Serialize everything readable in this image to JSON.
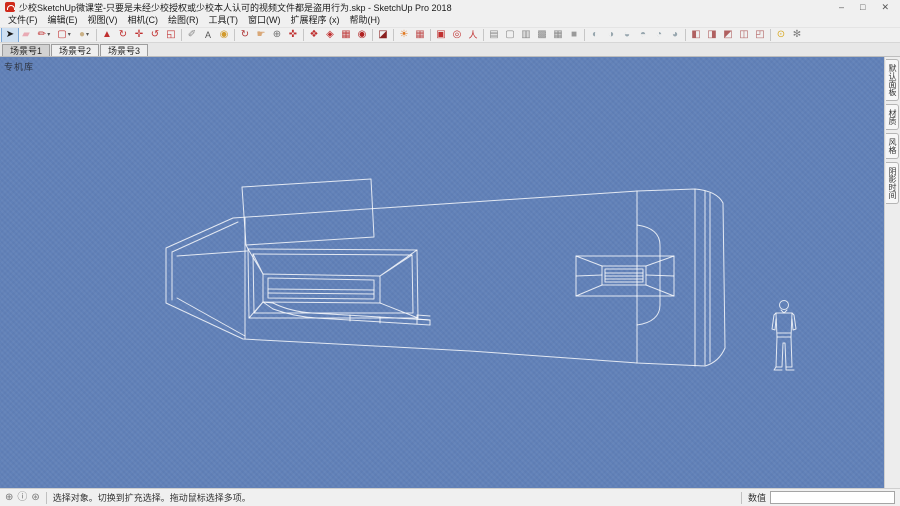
{
  "colors": {
    "viewport_bg": "#6181b8",
    "wireframe": "rgba(255,255,255,0.82)",
    "chrome_bg": "#f0f0f0",
    "logo_red": "#cf2a1b",
    "active_tool_bg": "#cfe0f2"
  },
  "window": {
    "title": "少校SketchUp微课堂-只要是未经少校授权或少校本人认可的视频文件都是盗用行为.skp - SketchUp Pro 2018",
    "controls": {
      "minimize": "–",
      "maximize": "□",
      "close": "✕"
    }
  },
  "menu": {
    "items": [
      {
        "label": "文件(F)"
      },
      {
        "label": "编辑(E)"
      },
      {
        "label": "视图(V)"
      },
      {
        "label": "相机(C)"
      },
      {
        "label": "绘图(R)"
      },
      {
        "label": "工具(T)"
      },
      {
        "label": "窗口(W)"
      },
      {
        "label": "扩展程序 (x)"
      },
      {
        "label": "帮助(H)"
      }
    ]
  },
  "toolbar": {
    "icons": [
      {
        "name": "select-tool-icon",
        "glyph": "➤",
        "style": "color:#1a1a1a",
        "cls": "active",
        "interactable": "true"
      },
      {
        "name": "eraser-tool-icon",
        "glyph": "▰",
        "style": "color:#e9aab4",
        "cls": "",
        "interactable": "true"
      },
      {
        "name": "line-tool-icon",
        "glyph": "✏",
        "style": "color:#c03030",
        "cls": "dd",
        "interactable": "true"
      },
      {
        "name": "shape-tool-icon",
        "glyph": "▢",
        "style": "color:#c03030",
        "cls": "dd",
        "interactable": "true"
      },
      {
        "name": "circle-tool-icon",
        "glyph": "●",
        "style": "color:#c9b086",
        "cls": "dd",
        "interactable": "true"
      },
      {
        "name": "separator",
        "glyph": "",
        "style": "",
        "cls": "tsep",
        "interactable": "false"
      },
      {
        "name": "push-pull-tool-icon",
        "glyph": "▲",
        "style": "color:#c03030",
        "cls": "",
        "interactable": "true"
      },
      {
        "name": "follow-me-tool-icon",
        "glyph": "↻",
        "style": "color:#c03030",
        "cls": "",
        "interactable": "true"
      },
      {
        "name": "move-tool-icon",
        "glyph": "✛",
        "style": "color:#c03030",
        "cls": "",
        "interactable": "true"
      },
      {
        "name": "rotate-tool-icon",
        "glyph": "↺",
        "style": "color:#c03030",
        "cls": "",
        "interactable": "true"
      },
      {
        "name": "scale-tool-icon",
        "glyph": "◱",
        "style": "color:#c03030",
        "cls": "",
        "interactable": "true"
      },
      {
        "name": "separator",
        "glyph": "",
        "style": "",
        "cls": "tsep",
        "interactable": "false"
      },
      {
        "name": "tape-measure-tool-icon",
        "glyph": "✐",
        "style": "color:#8a8a8a",
        "cls": "",
        "interactable": "true"
      },
      {
        "name": "dimension-tool-icon",
        "glyph": "A",
        "style": "color:#555;font-size:9px",
        "cls": "",
        "interactable": "true"
      },
      {
        "name": "paint-bucket-tool-icon",
        "glyph": "◉",
        "style": "color:#d19a2c",
        "cls": "",
        "interactable": "true"
      },
      {
        "name": "separator",
        "glyph": "",
        "style": "",
        "cls": "tsep",
        "interactable": "false"
      },
      {
        "name": "orbit-tool-icon",
        "glyph": "↻",
        "style": "color:#b03838",
        "cls": "",
        "interactable": "true"
      },
      {
        "name": "pan-tool-icon",
        "glyph": "☛",
        "style": "color:#d9a878",
        "cls": "",
        "interactable": "true"
      },
      {
        "name": "zoom-tool-icon",
        "glyph": "⊕",
        "style": "color:#707070",
        "cls": "",
        "interactable": "true"
      },
      {
        "name": "zoom-extents-tool-icon",
        "glyph": "✜",
        "style": "color:#c03030",
        "cls": "",
        "interactable": "true"
      },
      {
        "name": "separator",
        "glyph": "",
        "style": "",
        "cls": "tsep",
        "interactable": "false"
      },
      {
        "name": "make-component-icon",
        "glyph": "❖",
        "style": "color:#c03030",
        "cls": "",
        "interactable": "true"
      },
      {
        "name": "component-options-icon",
        "glyph": "◈",
        "style": "color:#c03030",
        "cls": "",
        "interactable": "true"
      },
      {
        "name": "component-attributes-icon",
        "glyph": "▦",
        "style": "color:#c04040",
        "cls": "",
        "interactable": "true"
      },
      {
        "name": "interact-tool-icon",
        "glyph": "◉",
        "style": "color:#b02020",
        "cls": "",
        "interactable": "true"
      },
      {
        "name": "separator",
        "glyph": "",
        "style": "",
        "cls": "tsep",
        "interactable": "false"
      },
      {
        "name": "section-plane-icon",
        "glyph": "◪",
        "style": "color:#8a2020",
        "cls": "",
        "interactable": "true"
      },
      {
        "name": "separator",
        "glyph": "",
        "style": "",
        "cls": "tsep",
        "interactable": "false"
      },
      {
        "name": "shadows-icon",
        "glyph": "☀",
        "style": "color:#e07820",
        "cls": "",
        "interactable": "true"
      },
      {
        "name": "fog-icon",
        "glyph": "▦",
        "style": "color:#c05050",
        "cls": "",
        "interactable": "true"
      },
      {
        "name": "separator",
        "glyph": "",
        "style": "",
        "cls": "tsep",
        "interactable": "false"
      },
      {
        "name": "position-camera-icon",
        "glyph": "▣",
        "style": "color:#c03030",
        "cls": "",
        "interactable": "true"
      },
      {
        "name": "look-around-icon",
        "glyph": "◎",
        "style": "color:#c03030",
        "cls": "",
        "interactable": "true"
      },
      {
        "name": "walk-tool-icon",
        "glyph": "人",
        "style": "color:#c03030;font-size:9px",
        "cls": "",
        "interactable": "true"
      },
      {
        "name": "separator",
        "glyph": "",
        "style": "",
        "cls": "tsep",
        "interactable": "false"
      },
      {
        "name": "xray-style-icon",
        "glyph": "▤",
        "style": "color:#8a8a8a",
        "cls": "",
        "interactable": "true"
      },
      {
        "name": "wireframe-style-icon",
        "glyph": "▢",
        "style": "color:#8a8a8a",
        "cls": "",
        "interactable": "true"
      },
      {
        "name": "hidden-line-style-icon",
        "glyph": "▥",
        "style": "color:#8a8a8a",
        "cls": "",
        "interactable": "true"
      },
      {
        "name": "shaded-style-icon",
        "glyph": "▩",
        "style": "color:#8a8a8a",
        "cls": "",
        "interactable": "true"
      },
      {
        "name": "textured-style-icon",
        "glyph": "▦",
        "style": "color:#8a8a8a",
        "cls": "",
        "interactable": "true"
      },
      {
        "name": "monochrome-style-icon",
        "glyph": "■",
        "style": "color:#9a9a9a",
        "cls": "",
        "interactable": "true"
      },
      {
        "name": "separator",
        "glyph": "",
        "style": "",
        "cls": "tsep",
        "interactable": "false"
      },
      {
        "name": "add-location-icon",
        "glyph": "◐",
        "style": "color:#97a6ae",
        "cls": "",
        "interactable": "true"
      },
      {
        "name": "toggle-terrain-icon",
        "glyph": "◑",
        "style": "color:#97a6ae",
        "cls": "",
        "interactable": "true"
      },
      {
        "name": "photo-textures-icon",
        "glyph": "◒",
        "style": "color:#97a6ae",
        "cls": "",
        "interactable": "true"
      },
      {
        "name": "globe-icon",
        "glyph": "◓",
        "style": "color:#97a6ae",
        "cls": "",
        "interactable": "true"
      },
      {
        "name": "adv-camera-icon",
        "glyph": "◔",
        "style": "color:#97a6ae",
        "cls": "",
        "interactable": "true"
      },
      {
        "name": "camera-list-icon",
        "glyph": "◕",
        "style": "color:#97a6ae",
        "cls": "",
        "interactable": "true"
      },
      {
        "name": "separator",
        "glyph": "",
        "style": "",
        "cls": "tsep",
        "interactable": "false"
      },
      {
        "name": "warehouse-icon",
        "glyph": "◧",
        "style": "color:#b06060",
        "cls": "",
        "interactable": "true"
      },
      {
        "name": "share-model-icon",
        "glyph": "◨",
        "style": "color:#b06060",
        "cls": "",
        "interactable": "true"
      },
      {
        "name": "extension-warehouse-icon",
        "glyph": "◩",
        "style": "color:#b06060",
        "cls": "",
        "interactable": "true"
      },
      {
        "name": "layout-icon",
        "glyph": "◫",
        "style": "color:#b06060",
        "cls": "",
        "interactable": "true"
      },
      {
        "name": "style-builder-icon",
        "glyph": "◰",
        "style": "color:#b06060",
        "cls": "",
        "interactable": "true"
      },
      {
        "name": "separator",
        "glyph": "",
        "style": "",
        "cls": "tsep",
        "interactable": "false"
      },
      {
        "name": "geolocate-icon",
        "glyph": "⊙",
        "style": "color:#d8a820",
        "cls": "",
        "interactable": "true"
      },
      {
        "name": "preferences-icon",
        "glyph": "✻",
        "style": "color:#808080",
        "cls": "",
        "interactable": "true"
      }
    ]
  },
  "scene_tabs": {
    "tabs": [
      {
        "label": "场景号1",
        "cls": "active"
      },
      {
        "label": "场景号2",
        "cls": ""
      },
      {
        "label": "场景号3",
        "cls": ""
      }
    ]
  },
  "viewport": {
    "watermark": "专机库"
  },
  "side_tabs": {
    "tabs": [
      {
        "label": "默认面板"
      },
      {
        "label": "材质"
      },
      {
        "label": "风格"
      },
      {
        "label": "阴影时间"
      }
    ]
  },
  "status_bar": {
    "icons": [
      {
        "name": "geolocation-icon",
        "glyph": "⊕"
      },
      {
        "name": "credits-icon",
        "glyph": "ⓘ"
      },
      {
        "name": "help-icon",
        "glyph": "⊛"
      }
    ],
    "message": "选择对象。切换到扩充选择。拖动鼠标选择多项。",
    "measure_label": "数值",
    "measure_value": ""
  }
}
